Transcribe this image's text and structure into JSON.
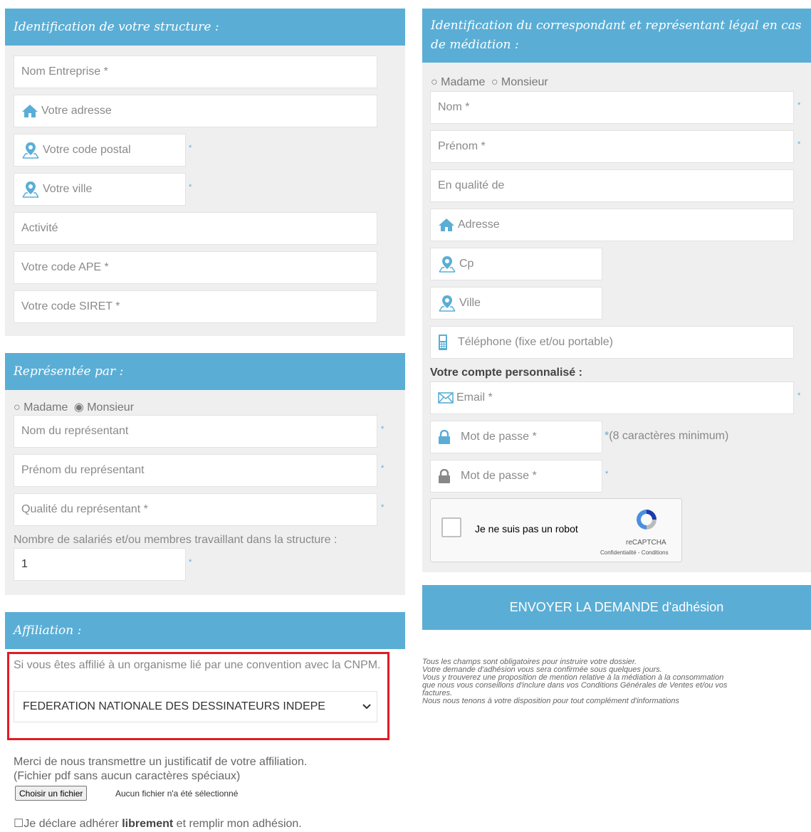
{
  "structure": {
    "title": "Identification de votre structure :",
    "nom_entreprise": "Nom Entreprise *",
    "adresse": "Votre adresse",
    "code_postal": "Votre code postal",
    "ville": "Votre ville",
    "activite": "Activité",
    "code_ape": "Votre code APE *",
    "code_siret": "Votre code SIRET *"
  },
  "representee": {
    "title": "Représentée par :",
    "madame": "Madame",
    "monsieur": "Monsieur",
    "selected": "Monsieur",
    "nom": "Nom du représentant",
    "prenom": "Prénom du représentant",
    "qualite": "Qualité du représentant *",
    "nb_label": "Nombre de salariés et/ou membres travaillant dans la structure :",
    "nb_value": "1"
  },
  "affiliation": {
    "title": "Affiliation :",
    "question": "Si vous êtes affilié à un organisme lié par une convention avec la CNPM.",
    "selected": "FEDERATION NATIONALE DES DESSINATEURS INDEPE"
  },
  "justificatif": {
    "line1": "Merci de nous transmettre un justificatif de votre affiliation.",
    "line2": "(Fichier pdf sans aucun caractères spéciaux)",
    "file_button": "Choisir un fichier",
    "file_status": "Aucun fichier n'a été sélectionné"
  },
  "declaration": {
    "pre": "Je déclare adhérer ",
    "bold": "librement",
    "post": " et remplir mon adhésion."
  },
  "correspondant": {
    "title": "Identification du correspondant et représentant légal en cas de médiation :",
    "madame": "Madame",
    "monsieur": "Monsieur",
    "nom": "Nom *",
    "prenom": "Prénom *",
    "qualite": "En qualité de",
    "adresse": "Adresse",
    "cp": "Cp",
    "ville": "Ville",
    "telephone": "Téléphone (fixe et/ou portable)"
  },
  "compte": {
    "title": "Votre compte personnalisé :",
    "email": "Email *",
    "password": "Mot de passe *",
    "password_hint": "(8 caractères minimum)",
    "password_confirm": "Mot de passe *"
  },
  "recaptcha": {
    "label": "Je ne suis pas un robot",
    "brand": "reCAPTCHA",
    "links": "Confidentialité - Conditions"
  },
  "submit": "ENVOYER LA DEMANDE d'adhésion",
  "notes": [
    "Tous les champs sont obligatoires pour instruire votre dossier.",
    "Votre demande d'adhésion vous sera confirmée sous quelques jours.",
    "Vous y trouverez une proposition de mention relative à la médiation à la consommation",
    "que nous vous conseillons d'inclure dans vos Conditions Générales de Ventes et/ou vos",
    "factures.",
    "Nous nous tenons à votre disposition pour tout complément d'informations"
  ],
  "required_mark": "*",
  "colors": {
    "header": "#5aaed6",
    "panel": "#efefef",
    "highlight": "#e21b23"
  }
}
